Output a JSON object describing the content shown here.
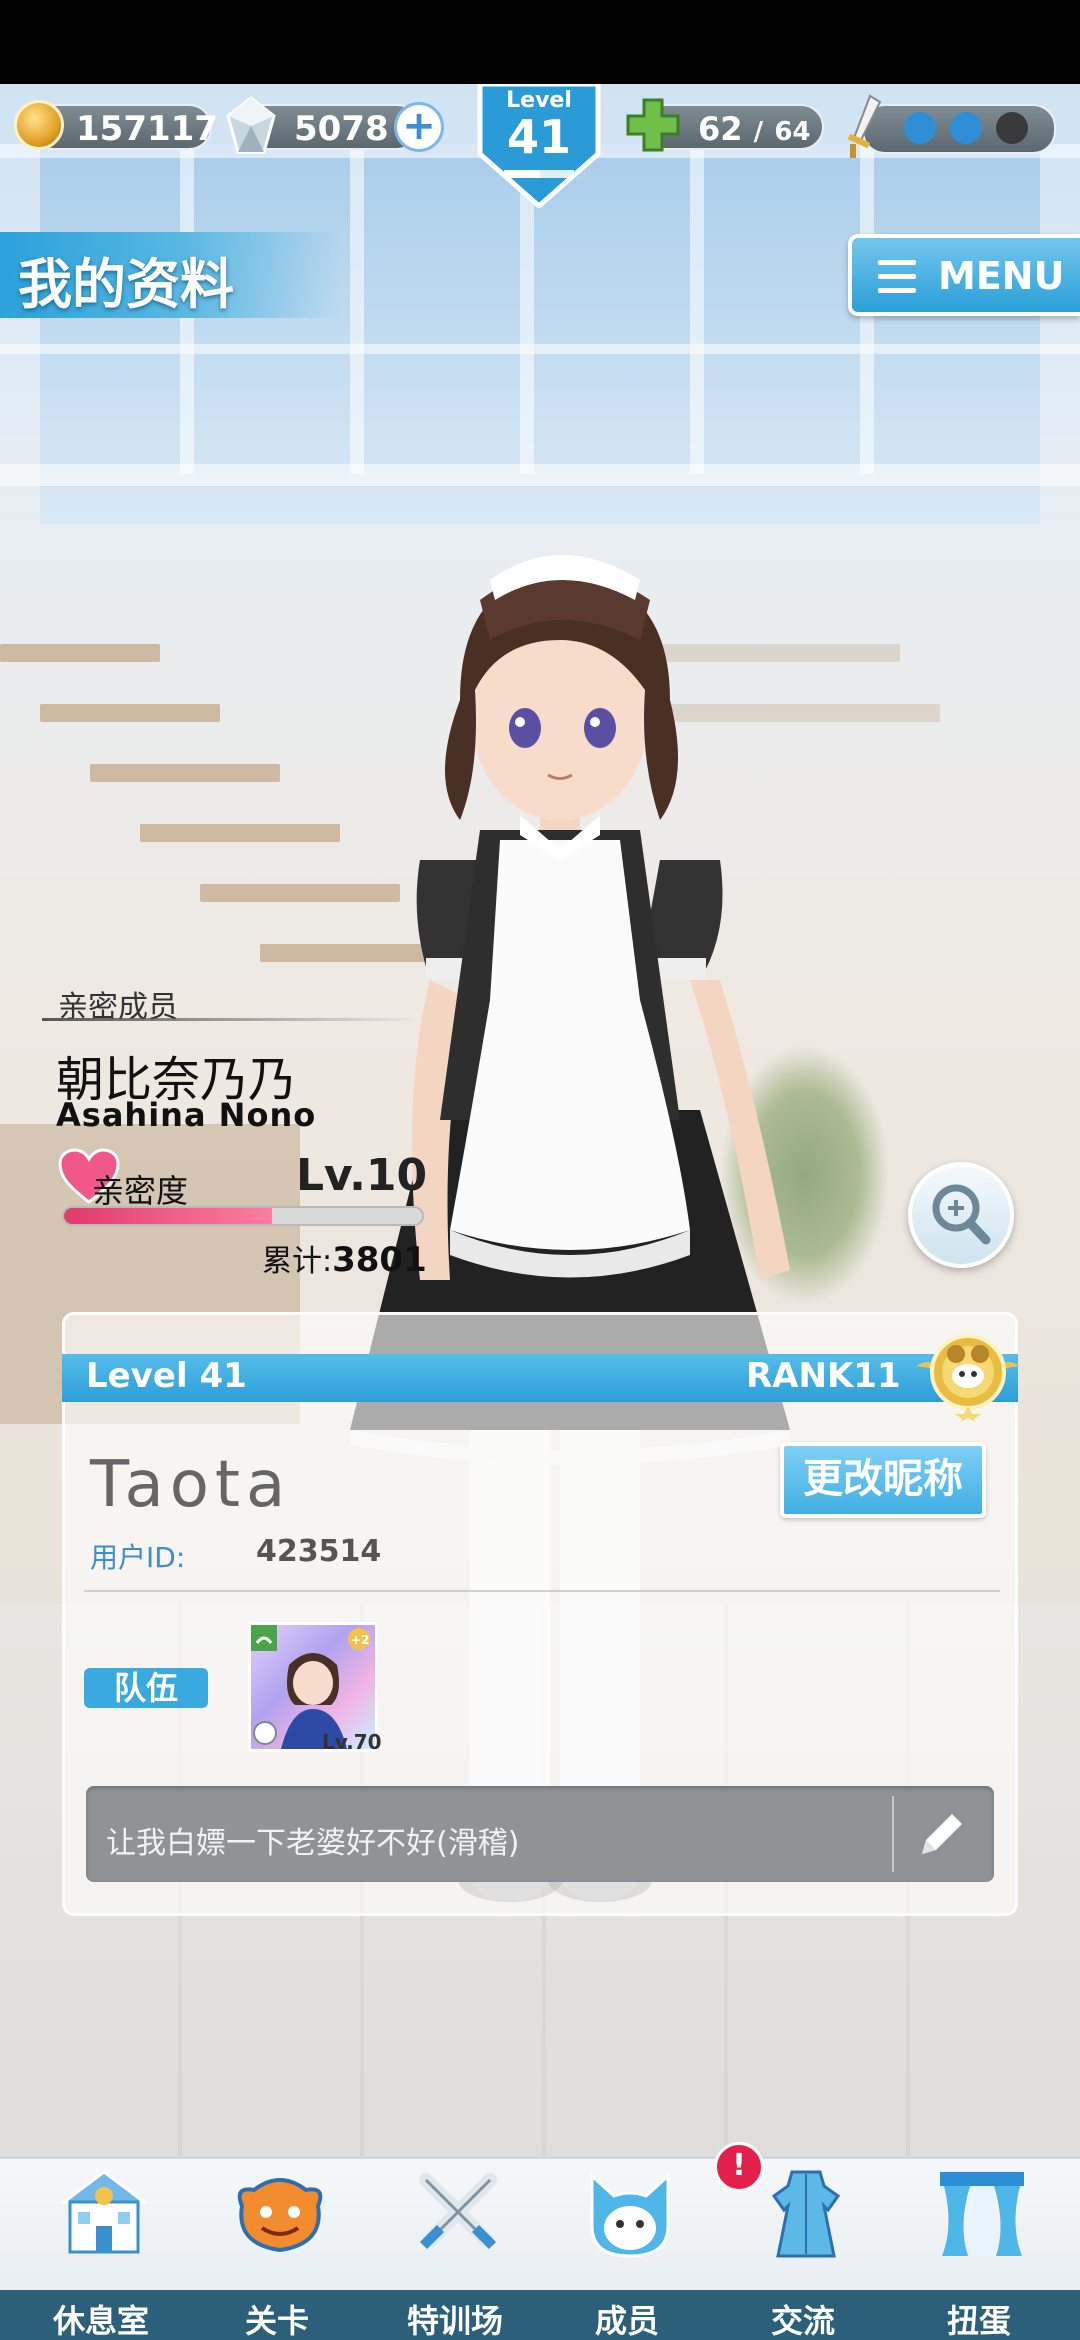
{
  "topbar": {
    "coins": "157117",
    "gems": "5078",
    "level_label": "Level",
    "level": "41",
    "stamina_current": "62",
    "stamina_sep": "/",
    "stamina_max": "64"
  },
  "header": {
    "title": "我的资料",
    "menu_label": "MENU"
  },
  "partner": {
    "tag": "亲密成员",
    "name": "朝比奈乃乃",
    "name_roman": "Asahina Nono",
    "affinity_label": "亲密度",
    "affinity_level": "Lv.10",
    "affinity_progress": 0.58,
    "accum_label": "累计:",
    "accum_value": "3801"
  },
  "profile": {
    "level": "Level 41",
    "rank": "RANK11",
    "username": "Taota",
    "uid_label": "用户ID:",
    "uid": "423514",
    "rename_label": "更改昵称",
    "team_label": "队伍",
    "member_level": "Lv.70",
    "member_plus": "+2",
    "message": "让我白嫖一下老婆好不好(滑稽)"
  },
  "nav": {
    "items": [
      {
        "label": "休息室",
        "icon": "lounge-building-icon"
      },
      {
        "label": "关卡",
        "icon": "stage-monster-icon"
      },
      {
        "label": "特训场",
        "icon": "crossed-swords-icon"
      },
      {
        "label": "成员",
        "icon": "member-cat-icon"
      },
      {
        "label": "交流",
        "icon": "dress-icon"
      },
      {
        "label": "扭蛋",
        "icon": "curtain-stage-icon"
      }
    ],
    "alert": "!"
  },
  "colors": {
    "accent": "#2d9ed8",
    "nav_strip": "#2c5f7a",
    "affinity": "#e03b6d",
    "alert": "#e41f4a"
  }
}
